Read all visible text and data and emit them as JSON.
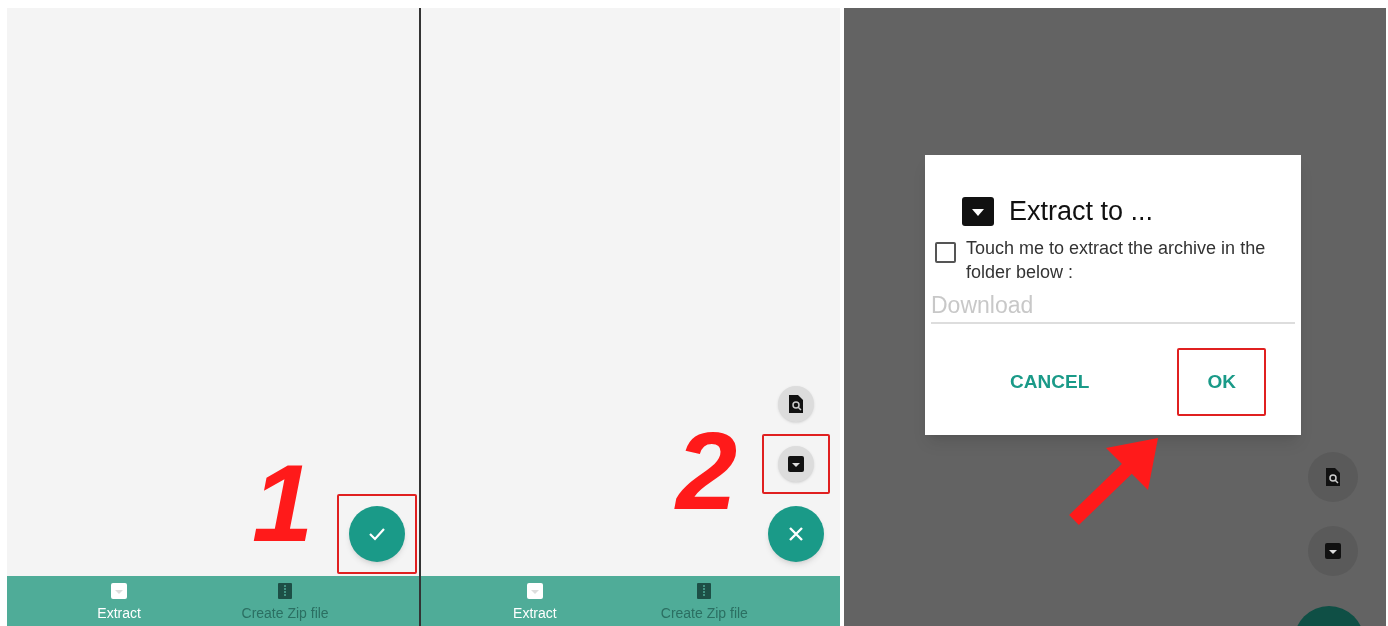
{
  "panels": [
    {
      "kind": "list",
      "step": "1",
      "fab": {
        "highlighted": true
      },
      "bottom_nav": [
        {
          "label": "Extract",
          "selected": true
        },
        {
          "label": "Create Zip file",
          "selected": false
        }
      ]
    },
    {
      "kind": "list",
      "step": "2",
      "fab": {
        "highlighted": false
      },
      "mini_buttons": [
        {
          "highlighted": false
        },
        {
          "highlighted": true
        }
      ],
      "bottom_nav": [
        {
          "label": "Extract",
          "selected": true
        },
        {
          "label": "Create Zip file",
          "selected": false
        }
      ]
    },
    {
      "kind": "dialog",
      "dialog": {
        "title": "Extract to ...",
        "checkbox": {
          "label": "Touch me to extract the archive in the folder below :",
          "checked": false
        },
        "field": {
          "placeholder": "Download"
        },
        "buttons": [
          {
            "label": "CANCEL",
            "highlighted": false
          },
          {
            "label": "OK",
            "highlighted": true
          }
        ]
      }
    }
  ]
}
